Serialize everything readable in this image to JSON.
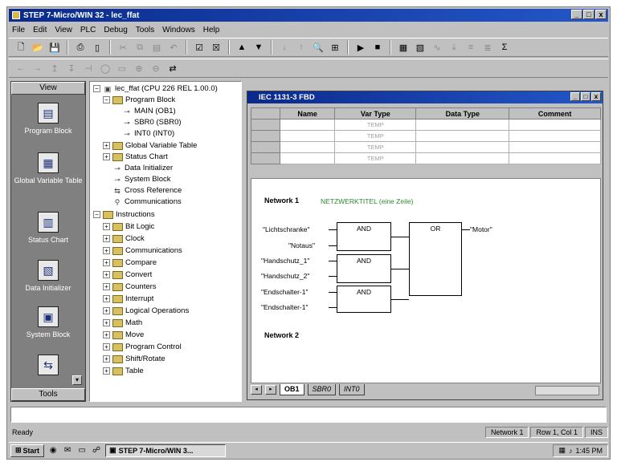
{
  "window": {
    "title": "STEP 7-Micro/WIN 32 - lec_ffat",
    "minimize_label": "_",
    "maximize_label": "□",
    "close_label": "x"
  },
  "menu": [
    "File",
    "Edit",
    "View",
    "PLC",
    "Debug",
    "Tools",
    "Windows",
    "Help"
  ],
  "toolbar1": [
    "new-icon",
    "open-icon",
    "save-icon",
    "print-icon",
    "print-preview-icon",
    "cut-icon",
    "copy-icon",
    "paste-icon",
    "undo-icon",
    "compile-icon",
    "compile-all-icon",
    "upload-icon",
    "download-icon",
    "sort-asc-icon",
    "sort-desc-icon",
    "find-icon",
    "options-icon",
    "run-icon",
    "stop-icon",
    "program-status-icon",
    "chart-status-icon",
    "trend-icon",
    "force-icon",
    "read-icon",
    "write-icon",
    "ladder-icon"
  ],
  "toolbar2": [
    "arrow-left-icon",
    "arrow-right-icon",
    "line-up-icon",
    "line-down-icon",
    "contact-icon",
    "coil-icon",
    "box-icon",
    "insert-network-icon",
    "delete-network-icon",
    "toggle-icon"
  ],
  "viewbar": {
    "header": "View",
    "footer": "Tools",
    "scroll_label": "▾",
    "items": [
      {
        "label": "Program Block",
        "icon": "program-block-icon",
        "glyph": "▤"
      },
      {
        "label": "Global Variable Table",
        "icon": "variable-table-icon",
        "glyph": "▦"
      },
      {
        "label": "Status Chart",
        "icon": "status-chart-icon",
        "glyph": "▥"
      },
      {
        "label": "Data Initializer",
        "icon": "data-initializer-icon",
        "glyph": "▧"
      },
      {
        "label": "System Block",
        "icon": "system-block-icon",
        "glyph": "▣"
      },
      {
        "label": "",
        "icon": "cross-reference-icon",
        "glyph": "⇆"
      }
    ]
  },
  "tree": {
    "root": "lec_ffat (CPU 226 REL 1.00.0)",
    "program_block": "Program Block",
    "main": "MAIN (OB1)",
    "sbr0": "SBR0 (SBR0)",
    "int0": "INT0 (INT0)",
    "global_var": "Global Variable Table",
    "status_chart": "Status Chart",
    "data_init": "Data Initializer",
    "system_block": "System Block",
    "cross_ref": "Cross Reference",
    "communications": "Communications",
    "instructions": "Instructions",
    "instruction_items": [
      "Bit Logic",
      "Clock",
      "Communications",
      "Compare",
      "Convert",
      "Counters",
      "Interrupt",
      "Logical Operations",
      "Math",
      "Move",
      "Program Control",
      "Shift/Rotate",
      "Table"
    ]
  },
  "editor": {
    "title": "IEC 1131-3 FBD",
    "columns": [
      "Name",
      "Var Type",
      "Data Type",
      "Comment"
    ],
    "rows": [
      {
        "var_type": "TEMP"
      },
      {
        "var_type": "TEMP"
      },
      {
        "var_type": "TEMP"
      },
      {
        "var_type": "TEMP"
      }
    ],
    "network1": {
      "label": "Network 1",
      "comment": "NETZWERKTITEL (eine Zeile)",
      "inputs": [
        "\"Lichtschranke\"",
        "\"Notaus\"",
        "\"Handschutz_1\"",
        "\"Handschutz_2\"",
        "\"Endschalter-1\"",
        "\"Endschalter-1\""
      ],
      "gate_and_label": "AND",
      "gate_or_label": "OR",
      "output": "\"Motor\""
    },
    "network2": {
      "label": "Network 2"
    },
    "tabs": [
      "OB1",
      "SBR0",
      "INT0"
    ],
    "nav_prev": "◂",
    "nav_next": "▸"
  },
  "status": {
    "ready": "Ready",
    "network": "Network 1",
    "position": "Row 1, Col 1",
    "mode": "INS"
  },
  "taskbar": {
    "start": "Start",
    "task": "STEP 7-Micro/WIN 3...",
    "time": "1:45 PM"
  }
}
